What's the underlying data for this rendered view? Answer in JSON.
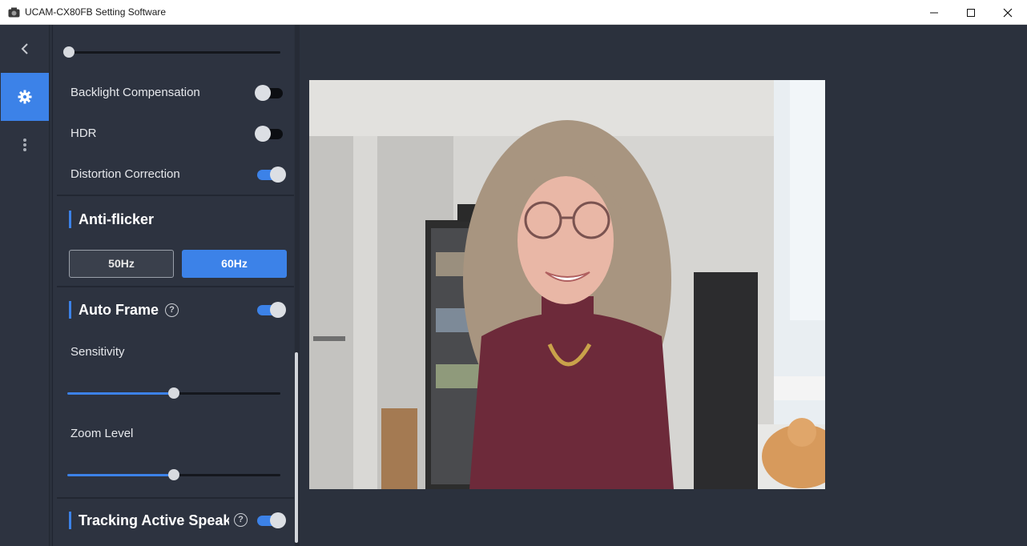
{
  "window": {
    "title": "UCAM-CX80FB Setting Software"
  },
  "nav": {
    "back_icon": "chevron-left-icon",
    "settings_icon": "gear-icon",
    "more_icon": "vertical-dots-icon"
  },
  "settings": {
    "backlight_compensation": {
      "label": "Backlight Compensation",
      "enabled": false
    },
    "hdr": {
      "label": "HDR",
      "enabled": false
    },
    "distortion_correction": {
      "label": "Distortion Correction",
      "enabled": true
    },
    "top_slider": {
      "value": 0
    },
    "anti_flicker": {
      "title": "Anti-flicker",
      "options": [
        "50Hz",
        "60Hz"
      ],
      "selected": "60Hz"
    },
    "auto_frame": {
      "title": "Auto Frame",
      "enabled": true,
      "sensitivity": {
        "label": "Sensitivity",
        "value": 0.5
      },
      "zoom_level": {
        "label": "Zoom Level",
        "value": 0.5
      }
    },
    "tracking_active_speaker": {
      "title": "Tracking Active Speaker",
      "enabled": true
    }
  },
  "colors": {
    "accent": "#3c82e8",
    "background": "#2b313d",
    "panel": "#2d3340"
  }
}
